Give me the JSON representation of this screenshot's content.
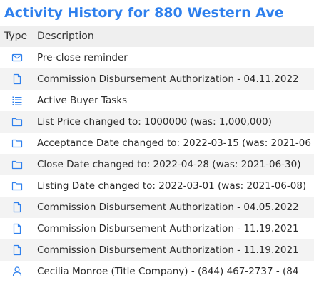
{
  "page_title": "Activity History for 880 Western Ave",
  "columns": {
    "type": "Type",
    "description": "Description"
  },
  "colors": {
    "accent": "#2f80ed",
    "icon": "#2f80ed",
    "text": "#2b2b2b",
    "row_alt_bg": "#f3f3f3"
  },
  "rows": [
    {
      "icon": "envelope-icon",
      "description": "Pre-close reminder"
    },
    {
      "icon": "document-icon",
      "description": "Commission Disbursement Authorization - 04.11.2022"
    },
    {
      "icon": "list-icon",
      "description": "Active Buyer Tasks"
    },
    {
      "icon": "folder-icon",
      "description": "List Price changed to: 1000000 (was: 1,000,000)"
    },
    {
      "icon": "folder-icon",
      "description": "Acceptance Date changed to: 2022-03-15 (was: 2021-06"
    },
    {
      "icon": "folder-icon",
      "description": "Close Date changed to: 2022-04-28 (was: 2021-06-30)"
    },
    {
      "icon": "folder-icon",
      "description": "Listing Date changed to: 2022-03-01 (was: 2021-06-08)"
    },
    {
      "icon": "document-icon",
      "description": "Commission Disbursement Authorization - 04.05.2022"
    },
    {
      "icon": "document-icon",
      "description": "Commission Disbursement Authorization - 11.19.2021"
    },
    {
      "icon": "document-icon",
      "description": "Commission Disbursement Authorization - 11.19.2021"
    },
    {
      "icon": "person-icon",
      "description": "Cecilia Monroe (Title Company) - (844) 467-2737 - (84"
    }
  ]
}
